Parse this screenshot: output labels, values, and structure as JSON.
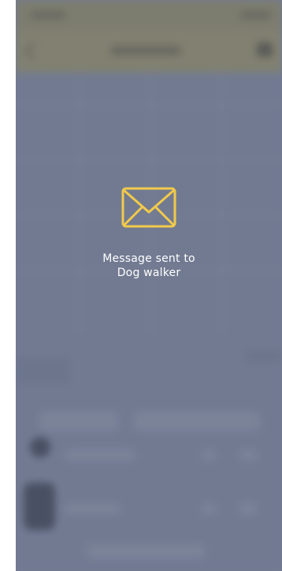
{
  "overlay": {
    "icon": "envelope-icon",
    "accent_color": "#F2C94C",
    "message_line1": "Message sent to",
    "message_line2": "Dog walker"
  }
}
